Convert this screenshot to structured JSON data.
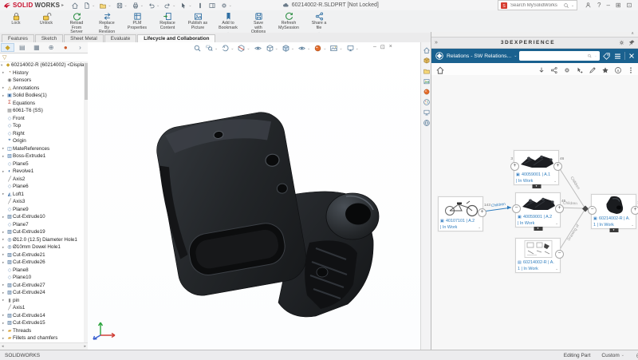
{
  "titlebar": {
    "logo_bold": "SOLID",
    "logo_light": "WORKS",
    "logo_caret": "▸",
    "document_title": "60214002-R.SLDPRT [Not Locked]",
    "search_placeholder": "Search MySolidWorks",
    "quick_access": [
      {
        "name": "home-button",
        "icon": "home"
      },
      {
        "name": "new-document-button",
        "icon": "newdoc",
        "caret": "⌄"
      },
      {
        "name": "open-button",
        "icon": "open",
        "caret": "⌄"
      },
      {
        "name": "save-button",
        "icon": "save",
        "caret": "⌄"
      },
      {
        "name": "print-button",
        "icon": "print",
        "caret": "⌄"
      },
      {
        "name": "undo-button",
        "icon": "undo",
        "caret": "⌄"
      },
      {
        "name": "redo-button",
        "icon": "redo",
        "caret": "⌄"
      },
      {
        "name": "select-button",
        "icon": "cursor",
        "caret": "⌄"
      },
      {
        "name": "selection-filter-button",
        "icon": "filterbar"
      },
      {
        "name": "task-pane-toggle",
        "icon": "panes"
      },
      {
        "name": "options-button",
        "icon": "gear",
        "caret": "⌄"
      }
    ],
    "window_controls": [
      {
        "name": "help-button",
        "glyph": "?"
      },
      {
        "name": "minimize-button",
        "glyph": "–"
      },
      {
        "name": "window-layout-button",
        "glyph": "⊞"
      },
      {
        "name": "restore-button",
        "glyph": "⊡"
      },
      {
        "name": "close-button",
        "glyph": "×"
      }
    ]
  },
  "ribbon": {
    "commands": [
      {
        "name": "lock",
        "icon": "lock",
        "label": "Lock"
      },
      {
        "name": "unlock",
        "icon": "unlock",
        "label": "Unlock"
      },
      {
        "name": "reload-from-server",
        "icon": "reload",
        "label": "Reload\nFrom\nServer"
      },
      {
        "name": "replace-by-revision",
        "icon": "replacerev",
        "label": "Replace\nBy\nRevision"
      },
      {
        "name": "plm-properties",
        "icon": "plm",
        "label": "PLM\nProperties"
      },
      {
        "name": "replace-content",
        "icon": "replacecontent",
        "label": "Replace\nContent"
      },
      {
        "name": "publish-as-picture",
        "icon": "publish",
        "label": "Publish as\nPicture",
        "caret": "⌄"
      },
      {
        "name": "add-to-bookmark",
        "icon": "bookmark",
        "label": "Add to\nBookmark",
        "caret": "⌄"
      },
      {
        "name": "save-with-options",
        "icon": "save",
        "label": "Save\nwith\nOptions",
        "caret": "⌄"
      },
      {
        "name": "refresh-mysession",
        "icon": "refresh",
        "label": "Refresh\nMySession"
      },
      {
        "name": "share-a-file",
        "icon": "share",
        "label": "Share a\nfile",
        "caret": "⌄"
      }
    ]
  },
  "tabs": {
    "items": [
      {
        "label": "Features"
      },
      {
        "label": "Sketch"
      },
      {
        "label": "Sheet Metal"
      },
      {
        "label": "Evaluate"
      },
      {
        "label": "Lifecycle and Collaboration",
        "cls": "active"
      }
    ]
  },
  "fm_tabs": [
    {
      "name": "featuremanager-design-tree-tab",
      "glyph": "◆",
      "cls": "active gold"
    },
    {
      "name": "propertymanager-tab",
      "glyph": "▤"
    },
    {
      "name": "configurationmanager-tab",
      "glyph": "▦"
    },
    {
      "name": "dimxpertmanager-tab",
      "glyph": "⊕"
    },
    {
      "name": "displaymanager-tab",
      "glyph": "●",
      "cls": "ball"
    },
    {
      "name": "fm-tabs-overflow",
      "glyph": "›"
    }
  ],
  "feature_tree": {
    "filter_glyph": "▽",
    "root_arrow": "▾",
    "root": "60214002-R (60214002) <Display St",
    "items": [
      {
        "label": "History",
        "icon": "history",
        "arrow": "▸"
      },
      {
        "label": "Sensors",
        "icon": "sensors"
      },
      {
        "label": "Annotations",
        "icon": "annotations",
        "arrow": "▸"
      },
      {
        "label": "Solid Bodies(1)",
        "icon": "solid-bodies",
        "arrow": "▸"
      },
      {
        "label": "Equations",
        "icon": "equations"
      },
      {
        "label": "6061-T6 (SS)",
        "icon": "material"
      },
      {
        "label": "Front",
        "icon": "plane"
      },
      {
        "label": "Top",
        "icon": "plane"
      },
      {
        "label": "Right",
        "icon": "plane"
      },
      {
        "label": "Origin",
        "icon": "origin"
      },
      {
        "label": "MateReferences",
        "icon": "mate-ref",
        "arrow": "▸"
      },
      {
        "label": "Boss-Extrude1",
        "icon": "boss",
        "arrow": "▸"
      },
      {
        "label": "Plane5",
        "icon": "plane"
      },
      {
        "label": "Revolve1",
        "icon": "revolve",
        "arrow": "▸"
      },
      {
        "label": "Axis2",
        "icon": "axis"
      },
      {
        "label": "Plane6",
        "icon": "plane"
      },
      {
        "label": "Loft1",
        "icon": "loft",
        "arrow": "▸"
      },
      {
        "label": "Axis3",
        "icon": "axis"
      },
      {
        "label": "Plane9",
        "icon": "plane"
      },
      {
        "label": "Cut-Extrude10",
        "icon": "cut",
        "arrow": "▸"
      },
      {
        "label": "Plane7",
        "icon": "plane"
      },
      {
        "label": "Cut-Extrude19",
        "icon": "cut",
        "arrow": "▸"
      },
      {
        "label": "Ø12.0 (12.5) Diameter Hole1",
        "icon": "hole",
        "arrow": "▸"
      },
      {
        "label": "Ø10mm Dowel Hole1",
        "icon": "hole",
        "arrow": "▸"
      },
      {
        "label": "Cut-Extrude21",
        "icon": "cut",
        "arrow": "▸"
      },
      {
        "label": "Cut-Extrude26",
        "icon": "cut",
        "arrow": "▸"
      },
      {
        "label": "Plane8",
        "icon": "plane"
      },
      {
        "label": "Plane10",
        "icon": "plane"
      },
      {
        "label": "Cut-Extrude27",
        "icon": "cut",
        "arrow": "▸"
      },
      {
        "label": "Cut-Extrude24",
        "icon": "cut",
        "arrow": "▸"
      },
      {
        "label": "pin",
        "icon": "pin",
        "arrow": "▸"
      },
      {
        "label": "Axis1",
        "icon": "axis"
      },
      {
        "label": "Cut-Extrude14",
        "icon": "cut",
        "arrow": "▸"
      },
      {
        "label": "Cut-Extrude15",
        "icon": "cut",
        "arrow": "▸"
      },
      {
        "label": "Threads",
        "icon": "folder",
        "arrow": "▸"
      },
      {
        "label": "Fillets and chamfers",
        "icon": "folder",
        "arrow": "▸"
      }
    ]
  },
  "headsup": {
    "icons": [
      {
        "name": "zoom-to-fit",
        "icon": "magnifier"
      },
      {
        "name": "zoom-to-area",
        "icon": "zoomarea",
        "caret": "⌄"
      },
      {
        "name": "previous-view",
        "icon": "prevview",
        "caret": "⌄"
      },
      {
        "name": "section-view",
        "icon": "section",
        "caret": "⌄"
      },
      {
        "name": "dynamic-annotation-views",
        "icon": "eye"
      },
      {
        "name": "view-orientation",
        "icon": "cube",
        "caret": "⌄"
      },
      {
        "name": "display-style",
        "icon": "dispstyle",
        "caret": "⌄"
      },
      {
        "name": "hide-show-items",
        "icon": "eye",
        "caret": "⌄"
      },
      {
        "name": "edit-appearance",
        "icon": "ball",
        "caret": "⌄"
      },
      {
        "name": "apply-scene",
        "icon": "scene",
        "caret": "⌄"
      },
      {
        "name": "view-settings",
        "icon": "monitor",
        "caret": "⌄"
      }
    ],
    "doc_controls": [
      {
        "name": "document-minimize",
        "glyph": "–"
      },
      {
        "name": "document-restore",
        "glyph": "⊡"
      },
      {
        "name": "document-close",
        "glyph": "×"
      }
    ]
  },
  "taskpane": {
    "icons": [
      {
        "name": "taskpane-home",
        "icon": "home"
      },
      {
        "name": "taskpane-solidworks-resources",
        "icon": "box"
      },
      {
        "name": "taskpane-design-library",
        "icon": "folder2"
      },
      {
        "name": "taskpane-view-palette",
        "icon": "image"
      },
      {
        "name": "taskpane-appearances-scenes",
        "icon": "ball"
      },
      {
        "name": "taskpane-custom-properties",
        "icon": "palette"
      },
      {
        "name": "taskpane-file-explorer",
        "icon": "monitor"
      },
      {
        "name": "taskpane-3dexperience-marketplace",
        "icon": "globe"
      }
    ]
  },
  "right_panel": {
    "top_arrow": "∧",
    "collapse_glyph": "»",
    "header_title": "3DEXPERIENCE",
    "widget_title": "Relations - SW Relations...",
    "widget_caret": "⌄",
    "search_placeholder": "",
    "toolbar_icons": [
      {
        "name": "expand-actions",
        "icon": "darr"
      },
      {
        "name": "share",
        "icon": "share2"
      },
      {
        "name": "settings",
        "icon": "gear"
      },
      {
        "name": "selection-mode",
        "icon": "cursorstar"
      },
      {
        "name": "edit",
        "icon": "pencil"
      },
      {
        "name": "favorites",
        "icon": "star"
      },
      {
        "name": "information",
        "icon": "info"
      },
      {
        "name": "more-options",
        "icon": "kebab"
      }
    ],
    "graph": {
      "nodes": [
        {
          "name": "node-40107101-a2",
          "pos": "pos-left",
          "thumb": "trike",
          "type_icon": "product",
          "title": "40107101 | A.2",
          "subtitle": "| In Work",
          "exp_right": "+",
          "exp_right_count": "143"
        },
        {
          "name": "node-40059001-a1",
          "pos": "pos-top",
          "thumb": "swingarm",
          "type_icon": "product",
          "title": "40059001 | A.1",
          "subtitle": "| In Work",
          "exp_left": "+",
          "exp_left_count": "3",
          "exp_right": "+",
          "exp_right_count": "46",
          "has_tab": true
        },
        {
          "name": "node-40059001-a2",
          "pos": "pos-mid",
          "thumb": "swingarm",
          "type_icon": "product",
          "title": "40059001 | A.2",
          "subtitle": "| In Work",
          "exp_left": "−",
          "exp_right": "+",
          "exp_right_count": "45",
          "has_tab": true
        },
        {
          "name": "node-60214002-drawing",
          "pos": "pos-bottom",
          "thumb": "drawing",
          "type_icon": "drawing",
          "title": "60214002-R | A.",
          "subtitle": "1 | In Work",
          "exp_right": "−"
        },
        {
          "name": "node-60214002-part",
          "pos": "pos-right",
          "thumb": "part",
          "type_icon": "product",
          "title": "60214002-R | A.",
          "subtitle": "1 | In Work",
          "exp_left": "−",
          "exp_right": "+",
          "exp_right_count": "1",
          "has_tab": true
        }
      ],
      "edges": [
        {
          "label": "Children"
        },
        {
          "label": "Children"
        },
        {
          "label": "Children"
        },
        {
          "label": "Drawing of"
        }
      ]
    }
  },
  "statusbar": {
    "app": "SOLIDWORKS",
    "mode": "Editing Part",
    "config": "Custom",
    "caret": "⌄"
  }
}
